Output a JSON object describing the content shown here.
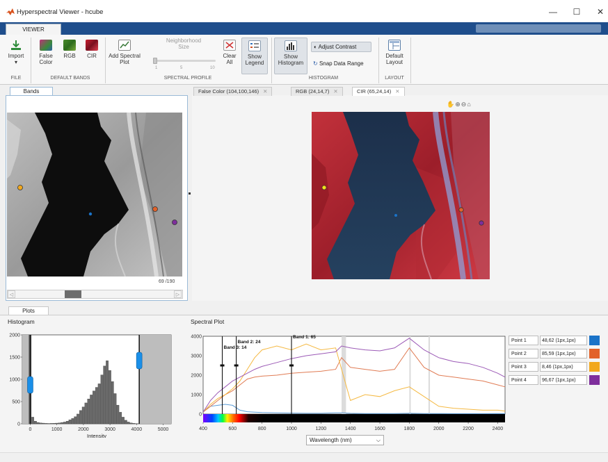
{
  "window": {
    "title": "Hyperspectral Viewer - hcube",
    "minimize": "—",
    "maximize": "☐",
    "close": "✕"
  },
  "toolstrip": {
    "tab": "VIEWER"
  },
  "ribbon": {
    "file": {
      "group": "FILE",
      "import": "Import",
      "import_arrow": "▾"
    },
    "default_bands": {
      "group": "DEFAULT BANDS",
      "false_color_1": "False",
      "false_color_2": "Color",
      "rgb": "RGB",
      "cir": "CIR"
    },
    "spectral_profile": {
      "group": "SPECTRAL PROFILE",
      "add_1": "Add Spectral",
      "add_2": "Plot",
      "neighborhood_1": "Neighborhood",
      "neighborhood_2": "Size",
      "ticks": [
        "1",
        "5",
        "10"
      ],
      "clear_1": "Clear",
      "clear_2": "All",
      "legend_1": "Show",
      "legend_2": "Legend"
    },
    "histogram": {
      "group": "HISTOGRAM",
      "show_1": "Show",
      "show_2": "Histogram",
      "adjust": "Adjust Contrast",
      "snap": "Snap Data Range"
    },
    "layout": {
      "group": "LAYOUT",
      "default_1": "Default",
      "default_2": "Layout"
    }
  },
  "bands": {
    "tab": "Bands",
    "band_counter": "69 /190"
  },
  "doc_tabs": [
    {
      "label": "False Color (104,100,146)"
    },
    {
      "label": "RGB (24,14,7)"
    },
    {
      "label": "CIR (65,24,14)"
    }
  ],
  "plots": {
    "tab": "Plots",
    "histogram_title": "Histogram",
    "spectral_title": "Spectral Plot",
    "wavelength_option": "Wavelength (nm)"
  },
  "histogram_chart": {
    "type": "bar",
    "xlabel": "Intensity",
    "xlim": [
      -300,
      5300
    ],
    "ylim": [
      0,
      2000
    ],
    "xticks": [
      0,
      1000,
      2000,
      3000,
      4000,
      5000
    ],
    "yticks": [
      0,
      500,
      1000,
      1500,
      2000
    ],
    "bin_width": 100,
    "bin_centers": [
      0,
      100,
      200,
      300,
      400,
      500,
      600,
      700,
      800,
      900,
      1000,
      1100,
      1200,
      1300,
      1400,
      1500,
      1600,
      1700,
      1800,
      1900,
      2000,
      2100,
      2200,
      2300,
      2400,
      2500,
      2600,
      2700,
      2800,
      2900,
      3000,
      3100,
      3200,
      3300,
      3400,
      3500,
      3600,
      3700,
      3800,
      3900,
      4000
    ],
    "counts": [
      2000,
      150,
      60,
      30,
      20,
      15,
      10,
      8,
      10,
      12,
      15,
      20,
      30,
      40,
      60,
      90,
      120,
      160,
      220,
      300,
      380,
      470,
      560,
      650,
      740,
      820,
      900,
      1100,
      1300,
      1420,
      1200,
      950,
      680,
      420,
      260,
      150,
      80,
      40,
      20,
      10,
      5
    ],
    "lower_limit": 0,
    "upper_limit": 4100
  },
  "spectral_chart": {
    "type": "line",
    "xlim": [
      400,
      2450
    ],
    "ylim": [
      0,
      4000
    ],
    "xticks": [
      400,
      600,
      800,
      1000,
      1200,
      1400,
      1600,
      1800,
      2000,
      2200,
      2400
    ],
    "yticks": [
      0,
      1000,
      2000,
      3000,
      4000
    ],
    "band_lines": [
      {
        "label": "Band 3: 14",
        "x": 530,
        "label_y": 3350
      },
      {
        "label": "Band 2: 24",
        "x": 625,
        "label_y": 3650
      },
      {
        "label": "Band 1: 65",
        "x": 1000,
        "label_y": 3900
      }
    ],
    "series": [
      {
        "name": "Point 1",
        "color": "#5b9bd5",
        "x": [
          400,
          450,
          500,
          550,
          600,
          650,
          700,
          750,
          800,
          900,
          1000,
          1100,
          1200,
          1300,
          1340,
          1400,
          1500,
          1600,
          1700,
          1800,
          1900,
          2000,
          2100,
          2200,
          2300,
          2400,
          2450
        ],
        "y": [
          150,
          400,
          450,
          500,
          450,
          200,
          120,
          100,
          80,
          60,
          50,
          40,
          40,
          60,
          60,
          40,
          30,
          30,
          30,
          40,
          30,
          30,
          20,
          20,
          20,
          30,
          20
        ]
      },
      {
        "name": "Point 2",
        "color": "#e07b53",
        "x": [
          400,
          450,
          500,
          550,
          600,
          650,
          700,
          750,
          800,
          900,
          1000,
          1100,
          1200,
          1300,
          1340,
          1400,
          1500,
          1600,
          1700,
          1800,
          1900,
          2000,
          2100,
          2200,
          2300,
          2400,
          2450
        ],
        "y": [
          100,
          400,
          700,
          1000,
          1200,
          1500,
          1800,
          1900,
          1950,
          2000,
          2100,
          2150,
          2200,
          2300,
          2900,
          2400,
          2300,
          2200,
          2300,
          3400,
          2400,
          2000,
          1900,
          1800,
          1700,
          1500,
          1400
        ]
      },
      {
        "name": "Point 3",
        "color": "#f5b942",
        "x": [
          400,
          450,
          500,
          550,
          600,
          650,
          700,
          750,
          800,
          900,
          1000,
          1100,
          1200,
          1300,
          1340,
          1400,
          1500,
          1600,
          1700,
          1800,
          1900,
          2000,
          2100,
          2200,
          2300,
          2400,
          2450
        ],
        "y": [
          100,
          500,
          800,
          1000,
          1300,
          1700,
          2300,
          2900,
          3300,
          3500,
          3300,
          3600,
          3300,
          3400,
          2300,
          700,
          1000,
          900,
          1200,
          1400,
          900,
          400,
          300,
          250,
          200,
          200,
          150
        ]
      },
      {
        "name": "Point 4",
        "color": "#9b59b6",
        "x": [
          400,
          450,
          500,
          550,
          600,
          650,
          700,
          750,
          800,
          900,
          1000,
          1100,
          1200,
          1300,
          1340,
          1400,
          1500,
          1600,
          1700,
          1800,
          1900,
          2000,
          2100,
          2200,
          2300,
          2400,
          2450
        ],
        "y": [
          100,
          700,
          1100,
          1400,
          1700,
          1900,
          2100,
          2300,
          2450,
          2650,
          2850,
          3000,
          3100,
          3200,
          3500,
          3400,
          3300,
          3250,
          3400,
          3900,
          3300,
          2900,
          2700,
          2600,
          2400,
          2100,
          1900
        ]
      }
    ]
  },
  "points": [
    {
      "name": "Point 1",
      "value": "48,62 (1px,1px)",
      "color": "#1a73c8"
    },
    {
      "name": "Point 2",
      "value": "85,59 (1px,1px)",
      "color": "#e2622a"
    },
    {
      "name": "Point 3",
      "value": "8,46 (1px,1px)",
      "color": "#f2a81d"
    },
    {
      "name": "Point 4",
      "value": "96,67 (1px,1px)",
      "color": "#7e2e9c"
    }
  ]
}
